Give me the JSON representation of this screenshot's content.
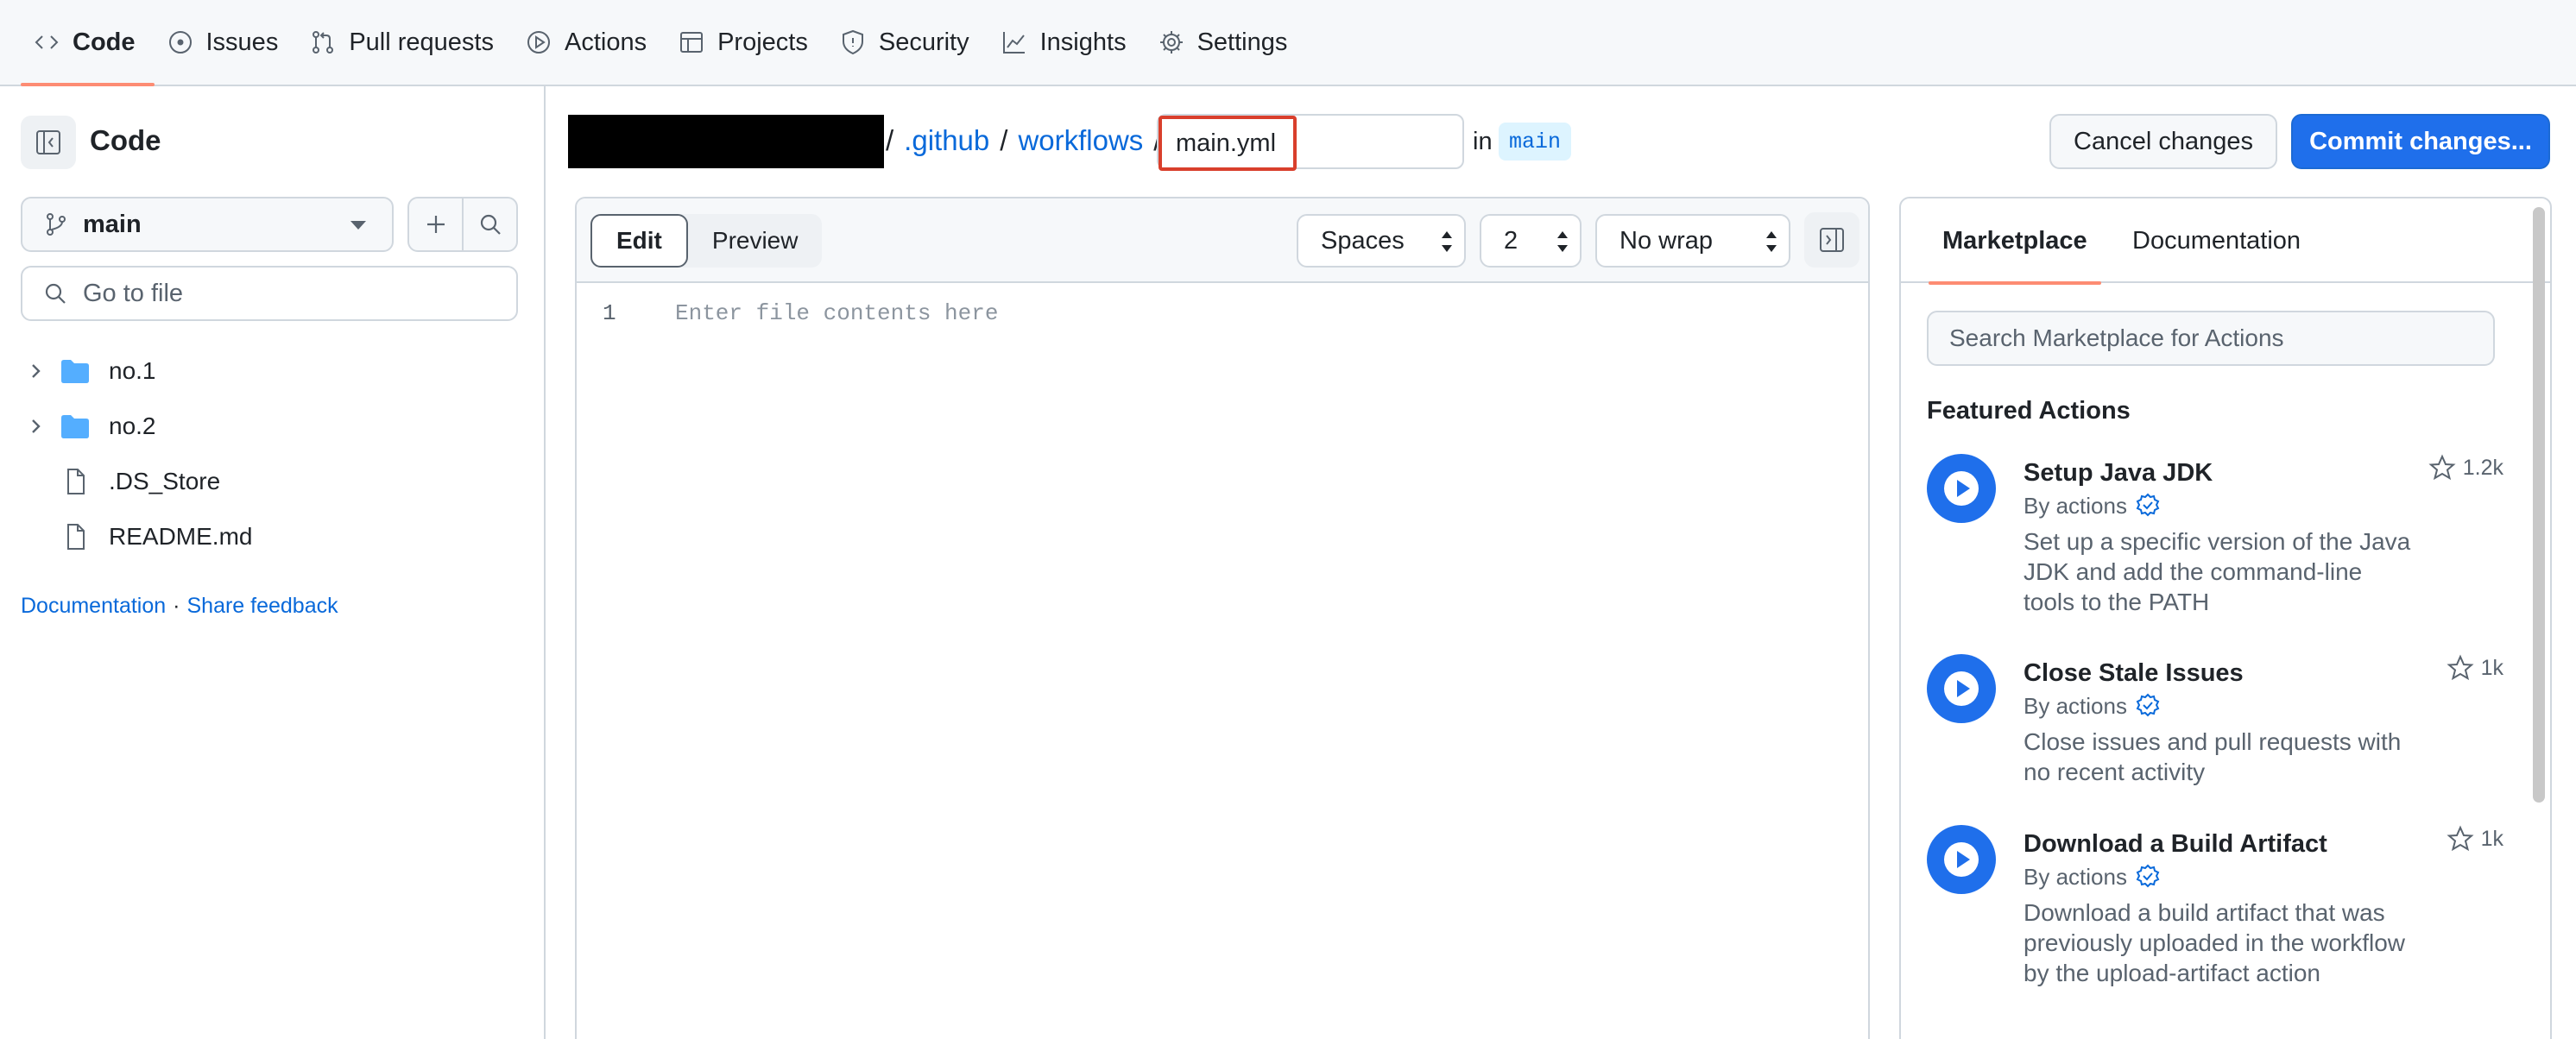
{
  "nav": {
    "tabs": [
      {
        "label": "Code",
        "icon": "code-icon",
        "selected": true
      },
      {
        "label": "Issues",
        "icon": "issue-opened-icon"
      },
      {
        "label": "Pull requests",
        "icon": "git-pull-request-icon"
      },
      {
        "label": "Actions",
        "icon": "play-icon"
      },
      {
        "label": "Projects",
        "icon": "table-icon"
      },
      {
        "label": "Security",
        "icon": "shield-icon"
      },
      {
        "label": "Insights",
        "icon": "graph-icon"
      },
      {
        "label": "Settings",
        "icon": "gear-icon"
      }
    ],
    "accent": "#fd8c73"
  },
  "sidebar": {
    "title": "Code",
    "branch": "main",
    "search_placeholder": "Go to file",
    "tree": [
      {
        "name": "no.1",
        "type": "folder"
      },
      {
        "name": "no.2",
        "type": "folder"
      },
      {
        "name": ".DS_Store",
        "type": "file"
      },
      {
        "name": "README.md",
        "type": "file"
      }
    ],
    "links": {
      "documentation": "Documentation",
      "separator": "·",
      "feedback": "Share feedback"
    }
  },
  "header": {
    "path": [
      ".github",
      "workflows"
    ],
    "separator": "/",
    "filename": "main.yml",
    "in_label": "in",
    "branch": "main",
    "cancel_label": "Cancel changes",
    "commit_label": "Commit changes..."
  },
  "editor": {
    "edit_label": "Edit",
    "preview_label": "Preview",
    "indent_mode": "Spaces",
    "indent_size": "2",
    "wrap_mode": "No wrap",
    "line_number": "1",
    "placeholder": "Enter file contents here"
  },
  "marketplace": {
    "tabs": [
      "Marketplace",
      "Documentation"
    ],
    "search_placeholder": "Search Marketplace for Actions",
    "featured_title": "Featured Actions",
    "actions": [
      {
        "title": "Setup Java JDK",
        "by": "By actions",
        "stars": "1.2k",
        "description": "Set up a specific version of the Java JDK and add the command-line tools to the PATH"
      },
      {
        "title": "Close Stale Issues",
        "by": "By actions",
        "stars": "1k",
        "description": "Close issues and pull requests with no recent activity"
      },
      {
        "title": "Download a Build Artifact",
        "by": "By actions",
        "stars": "1k",
        "description": "Download a build artifact that was previously uploaded in the workflow by the upload-artifact action"
      }
    ],
    "accent": "#1f6feb"
  }
}
